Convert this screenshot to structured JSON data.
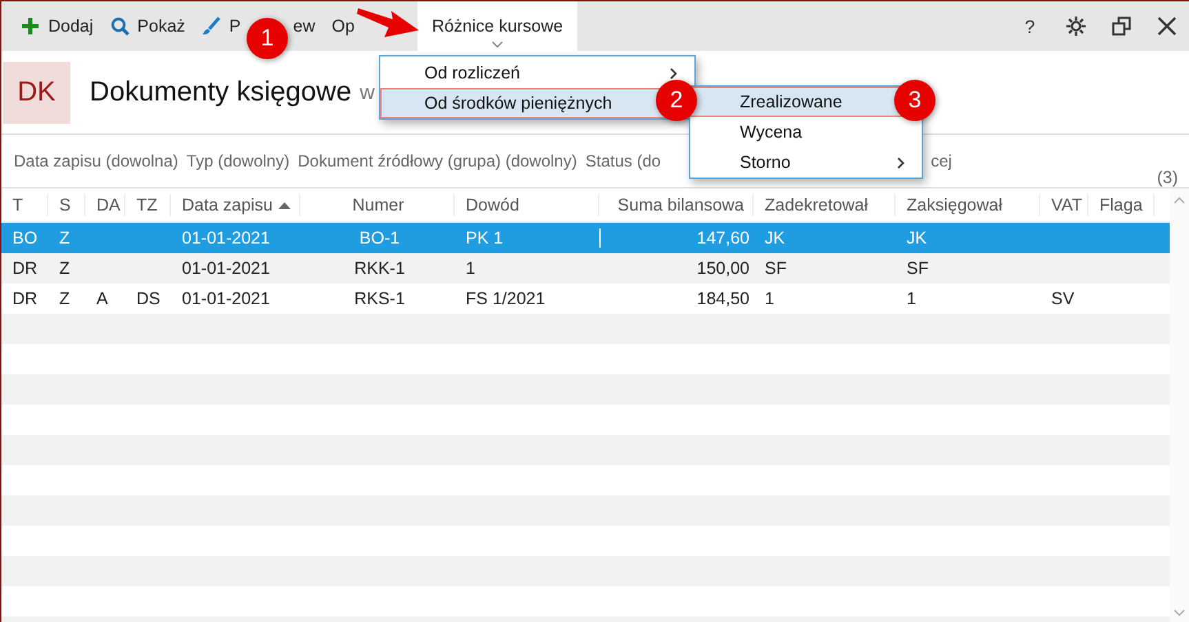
{
  "toolbar": {
    "buttons": [
      {
        "kind": "add",
        "label": "Dodaj",
        "expanded": false
      },
      {
        "kind": "search",
        "label": "Pokaż",
        "expanded": false
      },
      {
        "kind": "brush",
        "label": "P",
        "label_tail": "ew",
        "expanded": false
      },
      {
        "kind": "plain",
        "label": "Op",
        "expanded": false
      },
      {
        "kind": "plain",
        "label": "Różnice kursowe",
        "expanded": true
      }
    ],
    "window_buttons": [
      {
        "kind": "help",
        "label": "?"
      },
      {
        "kind": "settings"
      },
      {
        "kind": "restore"
      },
      {
        "kind": "close"
      }
    ]
  },
  "header": {
    "badge": "DK",
    "title": "Dokumenty księgowe",
    "subtitle": "w"
  },
  "filters": {
    "items": [
      "Data zapisu (dowolna)",
      "Typ (dowolny)",
      "Dokument źródłowy (grupa) (dowolny)",
      "Status (do",
      "cej"
    ],
    "count": "(3)"
  },
  "table": {
    "columns": [
      {
        "label": "T",
        "sorted": false
      },
      {
        "label": "S",
        "sorted": false
      },
      {
        "label": "DA",
        "sorted": false
      },
      {
        "label": "TZ",
        "sorted": false
      },
      {
        "label": "Data zapisu",
        "sorted": true
      },
      {
        "label": "Numer",
        "sorted": false
      },
      {
        "label": "Dowód",
        "sorted": false
      },
      {
        "label": "Suma bilansowa",
        "sorted": false
      },
      {
        "label": "Zadekretował",
        "sorted": false
      },
      {
        "label": "Zaksięgował",
        "sorted": false
      },
      {
        "label": "VAT",
        "sorted": false
      },
      {
        "label": "Flaga",
        "sorted": false
      }
    ],
    "rows": [
      {
        "selected": true,
        "cells": [
          "BO",
          "Z",
          "",
          "",
          "01-01-2021",
          "BO-1",
          "PK 1",
          "147,60",
          "JK",
          "JK",
          "",
          ""
        ]
      },
      {
        "selected": false,
        "cells": [
          "DR",
          "Z",
          "",
          "",
          "01-01-2021",
          "RKK-1",
          "1",
          "150,00",
          "SF",
          "SF",
          "",
          ""
        ]
      },
      {
        "selected": false,
        "cells": [
          "DR",
          "Z",
          "A",
          "DS",
          "01-01-2021",
          "RKS-1",
          "FS 1/2021",
          "184,50",
          "1",
          "1",
          "SV",
          ""
        ]
      }
    ]
  },
  "menu": {
    "items": [
      {
        "label": "Od rozliczeń",
        "submenu": true,
        "selected": false
      },
      {
        "label": "Od środków pieniężnych",
        "submenu": false,
        "selected": true
      }
    ]
  },
  "submenu": {
    "items": [
      {
        "label": "Zrealizowane",
        "submenu": false,
        "selected": true
      },
      {
        "label": "Wycena",
        "submenu": false,
        "selected": false
      },
      {
        "label": "Storno",
        "submenu": true,
        "selected": false
      }
    ]
  },
  "callouts": [
    "1",
    "2",
    "3"
  ]
}
